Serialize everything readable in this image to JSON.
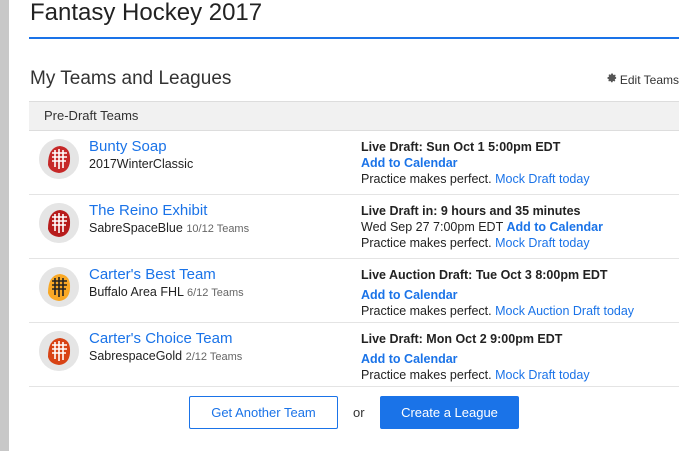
{
  "header": {
    "title": "Fantasy Hockey 2017"
  },
  "section": {
    "title": "My Teams and Leagues",
    "edit_teams": "Edit Teams"
  },
  "table": {
    "subhead": "Pre-Draft Teams",
    "rows": [
      {
        "team": "Bunty Soap",
        "league": "2017WinterClassic",
        "count": "",
        "draft": "Live Draft: Sun Oct 1 5:00pm EDT",
        "line2_text": "",
        "calendar": "Add to Calendar",
        "practice": "Practice makes perfect.",
        "mock": "Mock Draft today",
        "mask_color": "#c62828"
      },
      {
        "team": "The Reino Exhibit",
        "league": "SabreSpaceBlue",
        "count": "10/12 Teams",
        "draft": "Live Draft in: 9 hours and 35 minutes",
        "line2_text": "Wed Sep 27 7:00pm EDT",
        "calendar": "Add to Calendar",
        "practice": "Practice makes perfect.",
        "mock": "Mock Draft today",
        "mask_color": "#b71c1c"
      },
      {
        "team": "Carter's Best Team",
        "league": "Buffalo Area FHL",
        "count": "6/12 Teams",
        "draft": "Live Auction Draft: Tue Oct 3 8:00pm EDT",
        "line2_text": "",
        "calendar": "Add to Calendar",
        "practice": "Practice makes perfect.",
        "mock": "Mock Auction Draft today",
        "mask_color": "#f9a825"
      },
      {
        "team": "Carter's Choice Team",
        "league": "SabrespaceGold",
        "count": "2/12 Teams",
        "draft": "Live Draft: Mon Oct 2 9:00pm EDT",
        "line2_text": "",
        "calendar": "Add to Calendar",
        "practice": "Practice makes perfect.",
        "mock": "Mock Draft today",
        "mask_color": "#d84315"
      }
    ]
  },
  "actions": {
    "get_another_team": "Get Another Team",
    "or": "or",
    "create_league": "Create a League"
  },
  "colors": {
    "accent": "#1a73e8"
  }
}
